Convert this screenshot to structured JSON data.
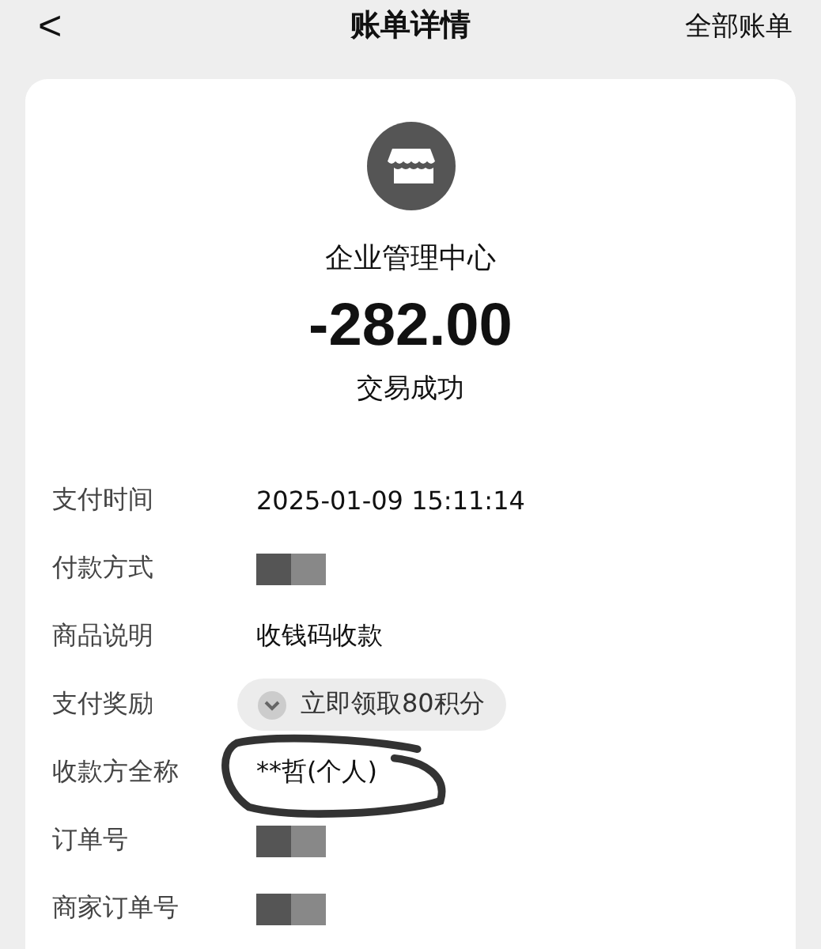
{
  "header": {
    "back": "<",
    "title": "账单详情",
    "action": "全部账单"
  },
  "merchant": {
    "name": "企业管理中心",
    "amount": "-282.00",
    "status": "交易成功"
  },
  "rows": [
    {
      "label": "支付时间",
      "kind": "text",
      "value": "2025-01-09 15:11:14"
    },
    {
      "label": "付款方式",
      "kind": "redacted"
    },
    {
      "label": "商品说明",
      "kind": "text",
      "value": "收钱码收款"
    },
    {
      "label": "支付奖励",
      "kind": "reward",
      "value": "立即领取80积分"
    },
    {
      "label": "收款方全称",
      "kind": "circled",
      "value": "**哲(个人)"
    },
    {
      "label": "订单号",
      "kind": "redacted"
    },
    {
      "label": "商家订单号",
      "kind": "redacted"
    }
  ]
}
